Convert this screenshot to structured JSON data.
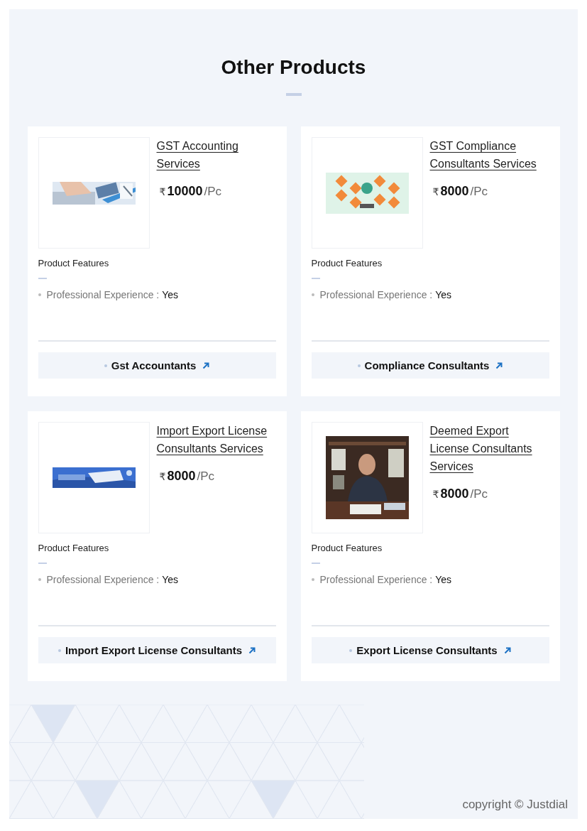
{
  "section_title": "Other Products",
  "products": [
    {
      "title": "GST Accounting Services",
      "currency": "₹",
      "amount": "10000",
      "unit": "/Pc",
      "features_heading": "Product Features",
      "features": [
        {
          "label": "Professional Experience :",
          "value": "Yes"
        }
      ],
      "category": "Gst Accountants"
    },
    {
      "title": "GST Compliance Consultants Services",
      "currency": "₹",
      "amount": "8000",
      "unit": "/Pc",
      "features_heading": "Product Features",
      "features": [
        {
          "label": "Professional Experience :",
          "value": "Yes"
        }
      ],
      "category": "Compliance Consultants"
    },
    {
      "title": "Import Export License Consultants Services",
      "currency": "₹",
      "amount": "8000",
      "unit": "/Pc",
      "features_heading": "Product Features",
      "features": [
        {
          "label": "Professional Experience :",
          "value": "Yes"
        }
      ],
      "category": "Import Export License Consultants"
    },
    {
      "title": "Deemed Export License Consultants Services",
      "currency": "₹",
      "amount": "8000",
      "unit": "/Pc",
      "features_heading": "Product Features",
      "features": [
        {
          "label": "Professional Experience :",
          "value": "Yes"
        }
      ],
      "category": "Export License Consultants"
    }
  ],
  "copyright": "copyright © Justdial"
}
